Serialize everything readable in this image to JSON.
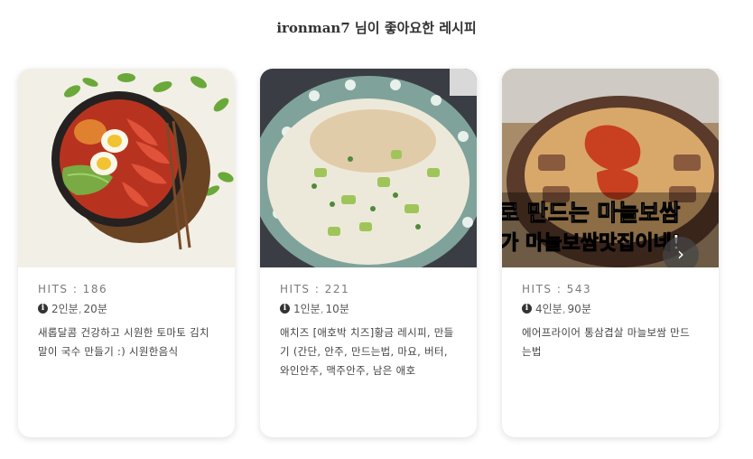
{
  "page": {
    "title": "ironman7 님이 좋아요한 레시피"
  },
  "recipes": [
    {
      "hits": "HITS : 186",
      "servings": "2인분",
      "time": "20분",
      "desc": "새롭달콤 건강하고 시원한 토마토 김치말이 국수 만들기 :) 시원한음식"
    },
    {
      "hits": "HITS : 221",
      "servings": "1인분",
      "time": "10분",
      "desc": "애치즈 [애호박 치즈]황금 레시피, 만들기 (간단, 안주, 만드는법, 마요, 버터, 와인안주, 맥주안주, 남은 애호"
    },
    {
      "hits": "HITS : 543",
      "servings": "4인분",
      "time": "90분",
      "desc": "에어프라이어 통삼겹살 마늘보쌈 만드는법",
      "overlay_line1": "로 만드는 마늘보쌈",
      "overlay_line2": "가 마늘보쌈맛집이네!"
    }
  ],
  "icons": {
    "info": "info-circle-icon",
    "next": "chevron-right-icon"
  },
  "controls": {
    "next_label": "›"
  }
}
